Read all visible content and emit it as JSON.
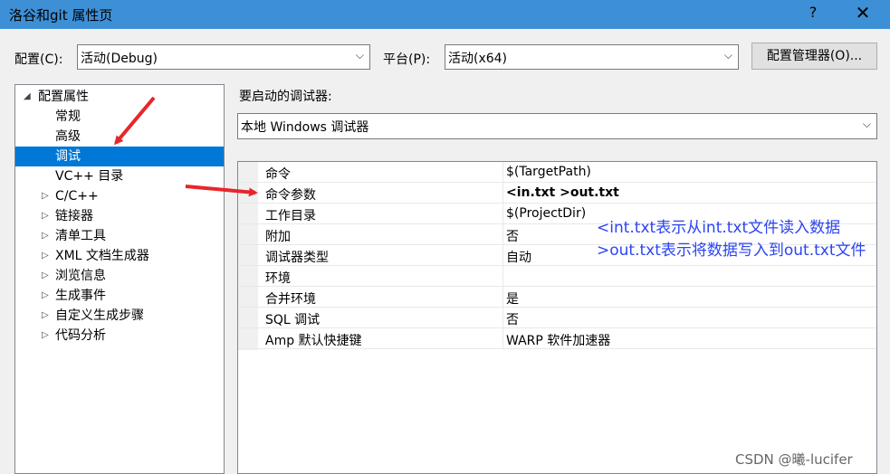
{
  "window": {
    "title": "洛谷和git 属性页",
    "help_glyph": "?",
    "close_glyph": "✕"
  },
  "config": {
    "label": "配置(C):",
    "value": "活动(Debug)"
  },
  "platform": {
    "label": "平台(P):",
    "value": "活动(x64)"
  },
  "config_manager_button": "配置管理器(O)...",
  "tree": {
    "root": "配置属性",
    "items": [
      {
        "label": "常规",
        "expandable": false,
        "selected": false
      },
      {
        "label": "高级",
        "expandable": false,
        "selected": false
      },
      {
        "label": "调试",
        "expandable": false,
        "selected": true
      },
      {
        "label": "VC++ 目录",
        "expandable": false,
        "selected": false
      },
      {
        "label": "C/C++",
        "expandable": true,
        "selected": false
      },
      {
        "label": "链接器",
        "expandable": true,
        "selected": false
      },
      {
        "label": "清单工具",
        "expandable": true,
        "selected": false
      },
      {
        "label": "XML 文档生成器",
        "expandable": true,
        "selected": false
      },
      {
        "label": "浏览信息",
        "expandable": true,
        "selected": false
      },
      {
        "label": "生成事件",
        "expandable": true,
        "selected": false
      },
      {
        "label": "自定义生成步骤",
        "expandable": true,
        "selected": false
      },
      {
        "label": "代码分析",
        "expandable": true,
        "selected": false
      }
    ]
  },
  "debugger": {
    "label": "要启动的调试器:",
    "value": "本地 Windows 调试器"
  },
  "properties": [
    {
      "name": "命令",
      "value": "$(TargetPath)"
    },
    {
      "name": "命令参数",
      "value": "<in.txt  >out.txt"
    },
    {
      "name": "工作目录",
      "value": "$(ProjectDir)"
    },
    {
      "name": "附加",
      "value": "否"
    },
    {
      "name": "调试器类型",
      "value": "自动"
    },
    {
      "name": "环境",
      "value": ""
    },
    {
      "name": "合并环境",
      "value": "是"
    },
    {
      "name": "SQL 调试",
      "value": "否"
    },
    {
      "name": "Amp 默认快捷键",
      "value": "WARP 软件加速器"
    }
  ],
  "annotations": {
    "line1": "<int.txt表示从int.txt文件读入数据",
    "line2": ">out.txt表示将数据写入到out.txt文件",
    "arrow_color": "#e8262a",
    "text_color": "#2b45f2"
  },
  "watermark": "CSDN @曦-lucifer",
  "icons": {
    "tree_expanded": "triangle-down-icon",
    "tree_collapsed": "triangle-right-icon",
    "combo_arrow": "chevron-down-icon"
  }
}
